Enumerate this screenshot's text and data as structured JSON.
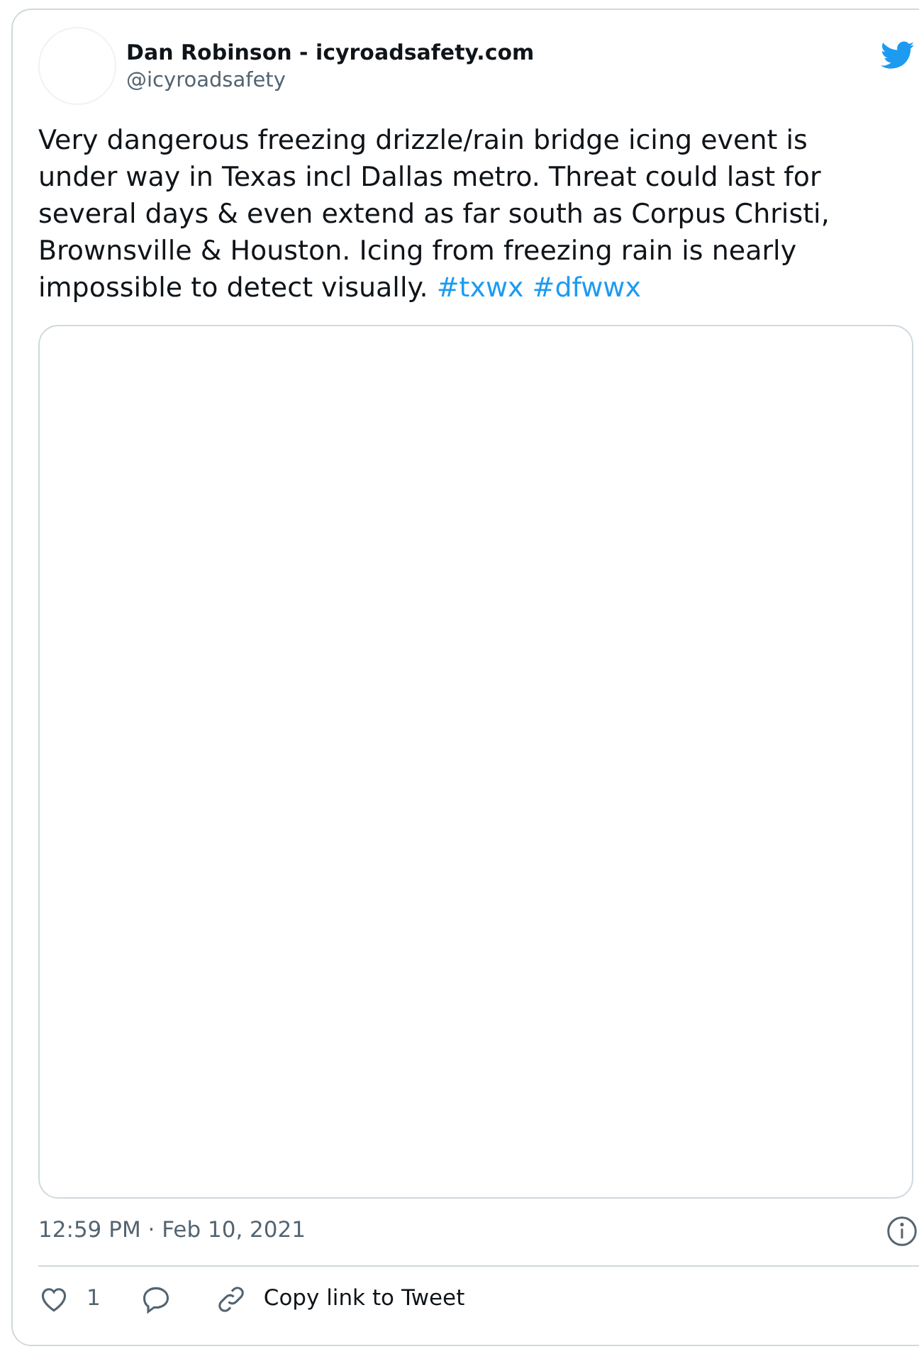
{
  "author": {
    "name": "Dan Robinson - icyroadsafety.com",
    "handle": "@icyroadsafety"
  },
  "text": "Very dangerous freezing drizzle/rain bridge icing event is under way in Texas incl Dallas metro. Threat could last for several days & even extend as far south as Corpus Christi, Brownsville & Houston. Icing from freezing rain is nearly impossible to detect visually.",
  "hashtags": [
    "#txwx",
    "#dfwwx"
  ],
  "timestamp": "12:59 PM · Feb 10, 2021",
  "actions": {
    "likes": "1",
    "copy_link": "Copy link to Tweet"
  }
}
